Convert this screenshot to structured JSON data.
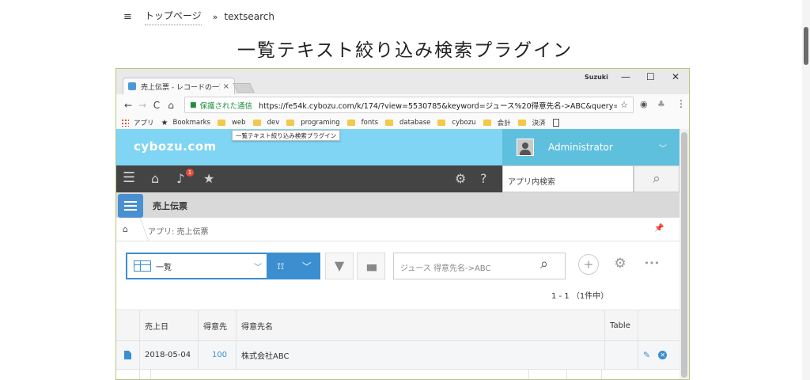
{
  "page": {
    "menu_icon": "≡",
    "breadcrumb_top": "トップページ",
    "breadcrumb_sep": "»",
    "breadcrumb_current": "textsearch",
    "title": "一覧テキスト絞り込み検索プラグイン"
  },
  "browser": {
    "tab_title": "売上伝票 - レコードの一覧",
    "tab_close": "×",
    "window_user": "Suzuki",
    "win_min": "—",
    "win_max": "☐",
    "win_close": "✕",
    "nav_back": "←",
    "nav_forward": "→",
    "nav_reload": "C",
    "nav_home": "⌂",
    "lock_icon": "🔒",
    "secure_label": "保護された通信",
    "url": "https://fe54k.cybozu.com/k/174/?view=5530785&keyword=ジュース%20得意先名->ABC&query=(ite...",
    "bookmark_star": "☆",
    "menu_dots": "⋮",
    "bookmarks": {
      "apps": "アプリ",
      "bookmarks": "Bookmarks",
      "web": "web",
      "dev": "dev",
      "programing": "programing",
      "fonts": "fonts",
      "database": "database",
      "cybozu": "cybozu",
      "accounting": "会計",
      "payment": "決済"
    },
    "tooltip": "一覧テキスト絞り込み検索プラグイン"
  },
  "kintone": {
    "logo": "cybozu.com",
    "user_name": "Administrator",
    "user_caret": "﹀",
    "notification_count": "1",
    "search_placeholder": "アプリ内検索",
    "search_icon_glyph": "⚲",
    "app_name": "売上伝票",
    "breadcrumb_home": "⌂",
    "breadcrumb_app": "アプリ: 売上伝票",
    "pin_glyph": "⊥",
    "view_name": "一覧",
    "view_caret": "﹀",
    "graph_glyph": "∿",
    "filter_glyph": "▼",
    "chart_glyph": "▮▮▮",
    "keyword_value": "ジュース 得意先名->ABC",
    "plus_glyph": "+",
    "gear_glyph": "⚙",
    "more_glyph": "•••",
    "record_count": "1 - 1 （1件中）",
    "columns": [
      "",
      "売上日",
      "得意先",
      "得意先名",
      "Table",
      ""
    ],
    "rows": [
      {
        "date": "2018-05-04",
        "customer": "100",
        "customer_name": "株式会社ABC",
        "edit_glyph": "✎",
        "delete_glyph": "✕"
      }
    ]
  },
  "colors": {
    "header_bg": "#7fd5f3",
    "user_area_bg": "#5fc0de",
    "dark_bar": "#444444",
    "accent_blue": "#3b8ed0",
    "secure_green": "#1e8e3e"
  }
}
